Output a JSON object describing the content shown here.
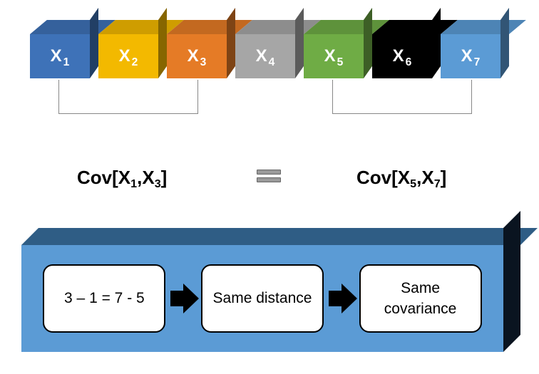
{
  "boxes": [
    {
      "label": "X",
      "sub": "1",
      "color": "#3e72b8"
    },
    {
      "label": "X",
      "sub": "2",
      "color": "#f3b900"
    },
    {
      "label": "X",
      "sub": "3",
      "color": "#e57b26"
    },
    {
      "label": "X",
      "sub": "4",
      "color": "#a6a6a6"
    },
    {
      "label": "X",
      "sub": "5",
      "color": "#6fac45"
    },
    {
      "label": "X",
      "sub": "6",
      "color": "#000000"
    },
    {
      "label": "X",
      "sub": "7",
      "color": "#5b9bd5"
    }
  ],
  "cov": {
    "left": {
      "fn": "Cov",
      "a": "X",
      "a_sub": "1",
      "b": "X",
      "b_sub": "3"
    },
    "right": {
      "fn": "Cov",
      "a": "X",
      "a_sub": "5",
      "b": "X",
      "b_sub": "7"
    }
  },
  "pills": {
    "p1": "3 – 1 = 7 - 5",
    "p2": "Same distance",
    "p3": "Same covariance"
  }
}
